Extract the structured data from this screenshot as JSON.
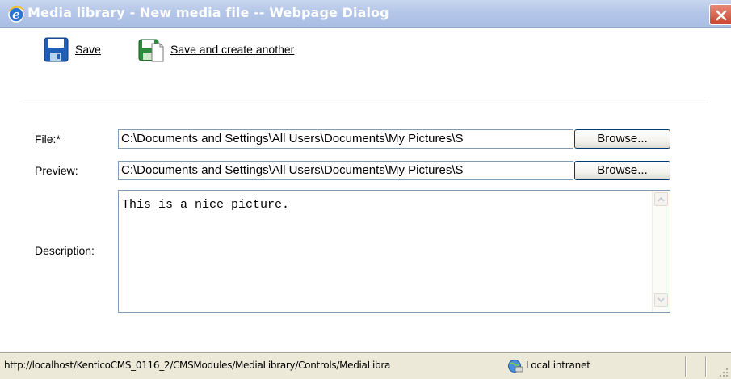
{
  "window": {
    "title": "Media library - New media file -- Webpage Dialog",
    "icons": {
      "app": "ie-icon",
      "close": "close-icon"
    }
  },
  "toolbar": {
    "save_label": "Save",
    "save_icon": "save-icon",
    "save_another_label": "Save and create another",
    "save_another_icon": "save-and-new-icon"
  },
  "form": {
    "file": {
      "label": "File:*",
      "value": "C:\\Documents and Settings\\All Users\\Documents\\My Pictures\\S",
      "button": "Browse..."
    },
    "preview": {
      "label": "Preview:",
      "value": "C:\\Documents and Settings\\All Users\\Documents\\My Pictures\\S",
      "button": "Browse..."
    },
    "description": {
      "label": "Description:",
      "value": "This is a nice picture."
    }
  },
  "statusbar": {
    "url": "http://localhost/KenticoCMS_0116_2/CMSModules/MediaLibrary/Controls/MediaLibra",
    "zone": "Local intranet",
    "zone_icon": "intranet-icon"
  },
  "colors": {
    "titlebar": "#b4c6e8",
    "close": "#c8452f",
    "statusbar": "#ece9d8",
    "input_border": "#7f9db9"
  }
}
